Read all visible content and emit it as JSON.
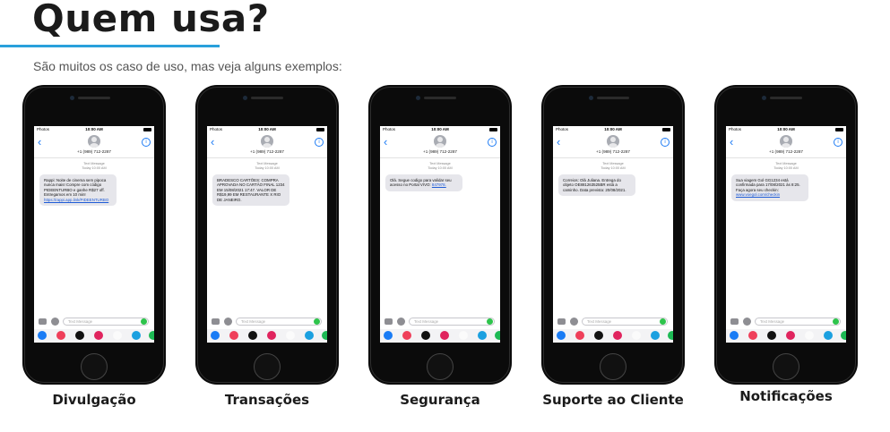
{
  "title": "Quem usa?",
  "subtitle": "São muitos os caso de uso, mas veja alguns exemplos:",
  "colors": {
    "accent": "#29a0db",
    "link": "#1e5bd6",
    "bubble": "#e6e6eb"
  },
  "phones": [
    {
      "status_left": "Photos",
      "time": "10:00 AM",
      "contact": "+1 (989) 712-2287",
      "meta_line1": "Text Message",
      "meta_line2": "Today 10:00 AM",
      "message": "Rappi: Noite de cinema sem pipoca nunca mais! Compre com código PIDEENTURBO e ganhe R$27 off. Entregamos em 10 min!",
      "link": "https://rappi.app.link/PIDEENTURBO",
      "input_placeholder": "Text Message",
      "caption": "Divulgação"
    },
    {
      "status_left": "Photos",
      "time": "10:00 AM",
      "contact": "+1 (989) 712-2287",
      "meta_line1": "Text Message",
      "meta_line2": "Today 10:00 AM",
      "message": "BRADESCO CARTÕES: COMPRA APROVADA NO CARTÃO FINAL 1234 EM 15/08/2021 17:47. VALOR DE R$19,99 EM RESTAURANTE X RIO DE JANEIRO.",
      "link": "",
      "input_placeholder": "Text Message",
      "caption": "Transações"
    },
    {
      "status_left": "Photos",
      "time": "10:00 AM",
      "contact": "+1 (989) 712-2287",
      "meta_line1": "Text Message",
      "meta_line2": "Today 10:00 AM",
      "message": "Olá. Segue codigo para validar seu acesso no Portal VIVO:",
      "link": "847978.",
      "input_placeholder": "Text Message",
      "caption": "Segurança"
    },
    {
      "status_left": "Photos",
      "time": "10:00 AM",
      "contact": "+1 (989) 712-2287",
      "meta_line1": "Text Message",
      "meta_line2": "Today 10:00 AM",
      "message": "Correios: Olá Juliana. Entrega do objeto OE881263525BR está a caminho. Data prevista: 20/08/2021.",
      "link": "",
      "input_placeholder": "Text Message",
      "caption": "Suporte ao Cliente"
    },
    {
      "status_left": "Photos",
      "time": "10:00 AM",
      "contact": "+1 (989) 712-2287",
      "meta_line1": "Text Message",
      "meta_line2": "Today 10:00 AM",
      "message": "Sua viagem Gol GG1234 está confirmada para 17/08/2021 às 8:25. Faça agora seu checkin:",
      "link": "www.voegol.com/checkin",
      "input_placeholder": "Text Message",
      "caption": "Notificações"
    }
  ]
}
